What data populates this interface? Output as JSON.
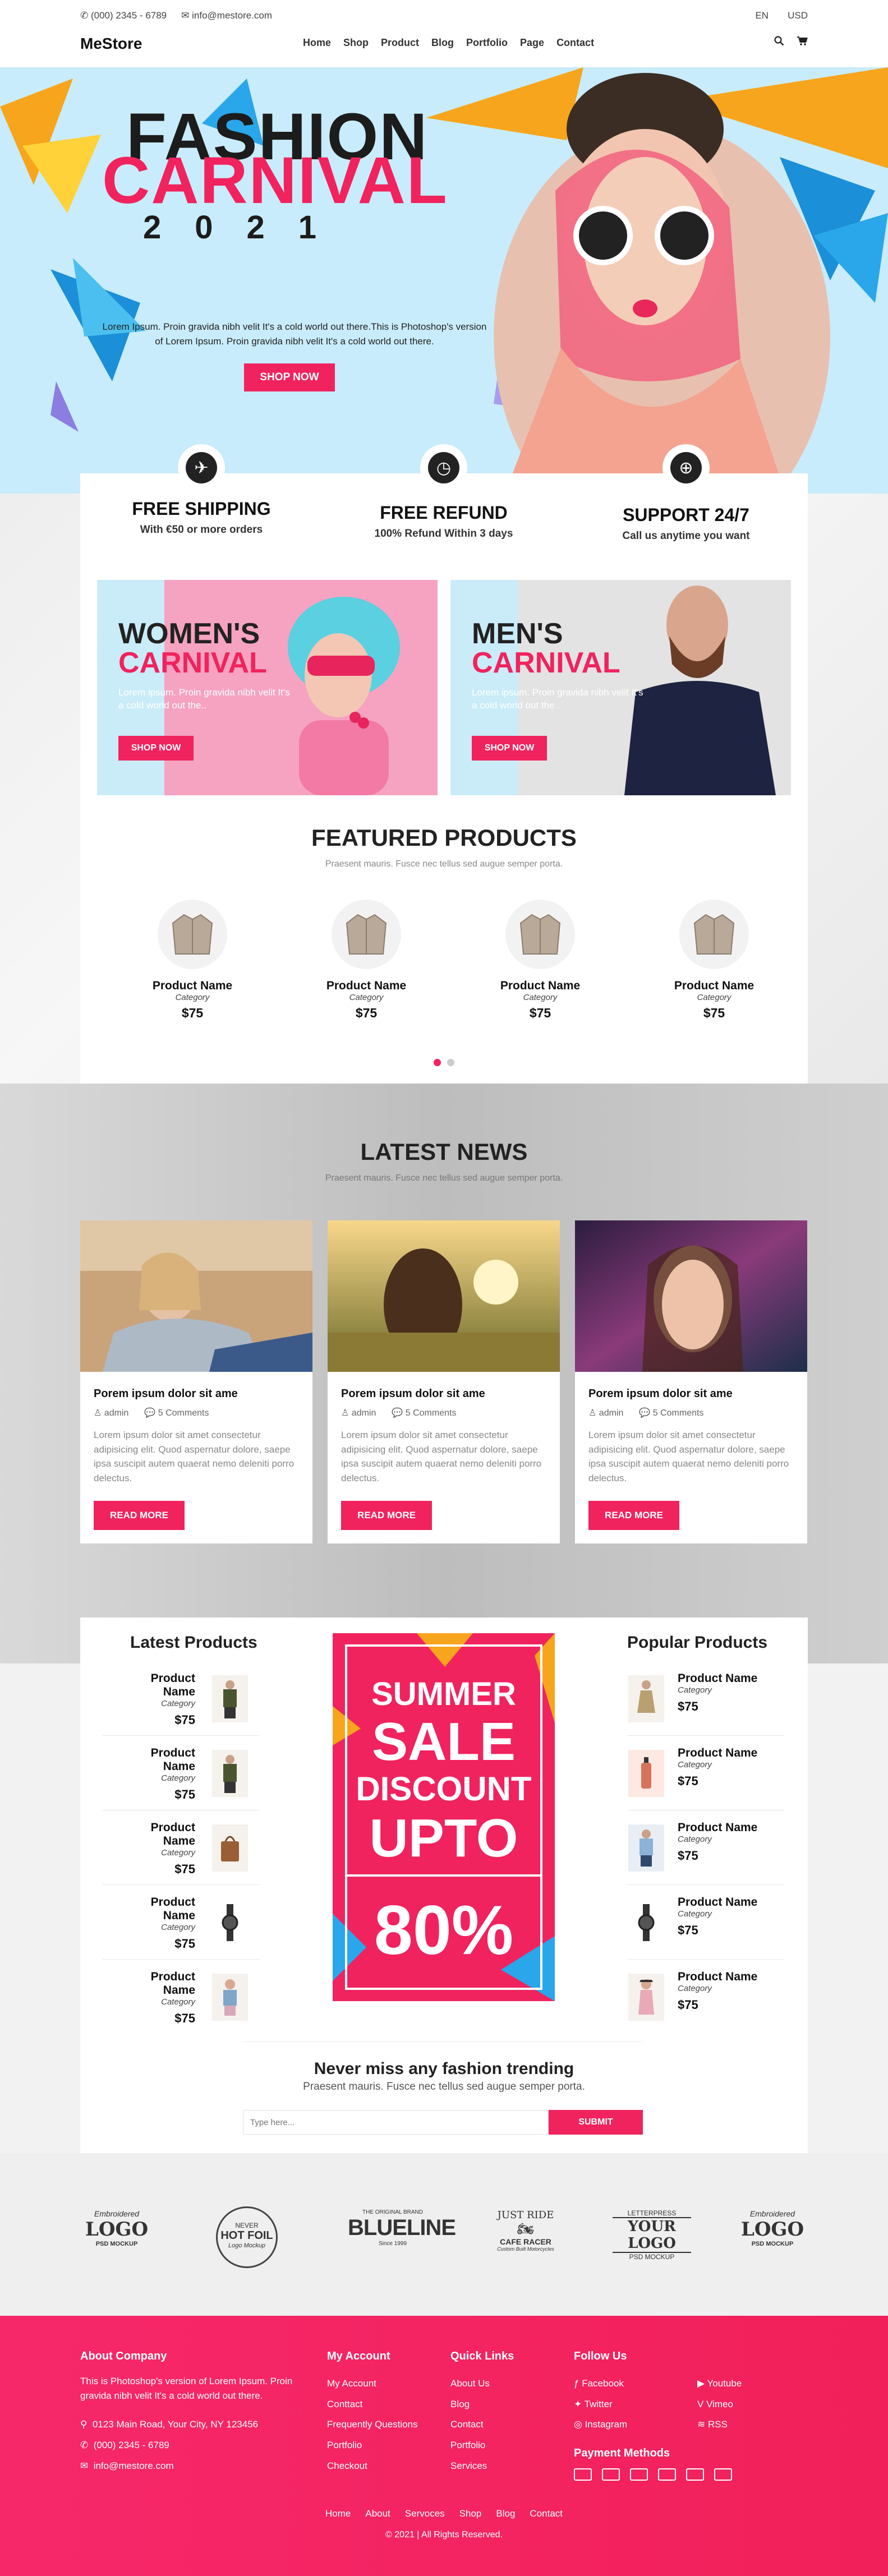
{
  "header": {
    "phone": "(000) 2345 - 6789",
    "email": "info@mestore.com",
    "language": "EN",
    "currency": "USD",
    "logo": "MeStore",
    "nav": [
      "Home",
      "Shop",
      "Product",
      "Blog",
      "Portfolio",
      "Page",
      "Contact"
    ]
  },
  "hero": {
    "title_line1": "FASHION",
    "title_line2": "CARNIVAL",
    "year": "2021",
    "description": "Lorem Ipsum. Proin gravida nibh velit It's a cold world out there.This is Photoshop's version of Lorem Ipsum. Proin gravida nibh velit It's a cold world out there.",
    "button": "SHOP NOW"
  },
  "features": [
    {
      "title": "FREE SHIPPING",
      "subtitle": "With €50 or more orders",
      "icon": "plane-icon"
    },
    {
      "title": "FREE REFUND",
      "subtitle": "100% Refund Within 3 days",
      "icon": "clock-icon"
    },
    {
      "title": "SUPPORT 24/7",
      "subtitle": "Call us anytime you want",
      "icon": "lifebuoy-icon"
    }
  ],
  "banners": [
    {
      "line1": "WOMEN'S",
      "line2": "CARNIVAL",
      "desc": "Lorem ipsum. Proin gravida nibh velit It's a cold world out the..",
      "button": "SHOP NOW"
    },
    {
      "line1": "MEN'S",
      "line2": "CARNIVAL",
      "desc": "Lorem ipsum. Proin gravida nibh velit It's a cold world out the..",
      "button": "SHOP NOW"
    }
  ],
  "featured": {
    "title": "FEATURED PRODUCTS",
    "subtitle": "Praesent mauris. Fusce nec tellus sed augue semper porta.",
    "products": [
      {
        "name": "Product Name",
        "category": "Category",
        "price": "$75"
      },
      {
        "name": "Product Name",
        "category": "Category",
        "price": "$75"
      },
      {
        "name": "Product Name",
        "category": "Category",
        "price": "$75"
      },
      {
        "name": "Product Name",
        "category": "Category",
        "price": "$75"
      }
    ]
  },
  "news": {
    "title": "LATEST NEWS",
    "subtitle": "Praesent mauris. Fusce nec tellus sed augue semper porta.",
    "posts": [
      {
        "title": "Porem ipsum dolor sit ame",
        "author": "admin",
        "comments": "5 Comments",
        "text": "Lorem ipsum dolor sit amet consectetur adipisicing elit. Quod aspernatur dolore, saepe ipsa suscipit autem quaerat nemo deleniti porro delectus.",
        "button": "READ MORE"
      },
      {
        "title": "Porem ipsum dolor sit ame",
        "author": "admin",
        "comments": "5 Comments",
        "text": "Lorem ipsum dolor sit amet consectetur adipisicing elit. Quod aspernatur dolore, saepe ipsa suscipit autem quaerat nemo deleniti porro delectus.",
        "button": "READ MORE"
      },
      {
        "title": "Porem ipsum dolor sit ame",
        "author": "admin",
        "comments": "5 Comments",
        "text": "Lorem ipsum dolor sit amet consectetur adipisicing elit. Quod aspernatur dolore, saepe ipsa suscipit autem quaerat nemo deleniti porro delectus.",
        "button": "READ MORE"
      }
    ]
  },
  "latest_products": {
    "title": "Latest Products",
    "items": [
      {
        "name": "Product Name",
        "category": "Category",
        "price": "$75"
      },
      {
        "name": "Product Name",
        "category": "Category",
        "price": "$75"
      },
      {
        "name": "Product Name",
        "category": "Category",
        "price": "$75"
      },
      {
        "name": "Product Name",
        "category": "Category",
        "price": "$75"
      },
      {
        "name": "Product Name",
        "category": "Category",
        "price": "$75"
      }
    ]
  },
  "popular_products": {
    "title": "Popular Products",
    "items": [
      {
        "name": "Product Name",
        "category": "Category",
        "price": "$75"
      },
      {
        "name": "Product Name",
        "category": "Category",
        "price": "$75"
      },
      {
        "name": "Product Name",
        "category": "Category",
        "price": "$75"
      },
      {
        "name": "Product Name",
        "category": "Category",
        "price": "$75"
      },
      {
        "name": "Product Name",
        "category": "Category",
        "price": "$75"
      }
    ]
  },
  "sale": {
    "line1": "SUMMER",
    "line2": "SALE",
    "line3": "DISCOUNT",
    "line4": "UPTO",
    "percent": "80%"
  },
  "newsletter": {
    "title": "Never miss any fashion trending",
    "subtitle": "Praesent mauris. Fusce nec tellus sed augue semper porta.",
    "placeholder": "Type here...",
    "button": "SUBMIT"
  },
  "brands": [
    {
      "top": "Embroidered",
      "main": "LOGO",
      "bottom": "PSD MOCKUP"
    },
    {
      "top": "NEVER",
      "main": "HOT FOIL",
      "bottom": "Logo Mockup"
    },
    {
      "top": "THE ORIGINAL BRAND",
      "main": "BLUELINE",
      "bottom": "Since 1999"
    },
    {
      "top": "JUST RIDE",
      "main": "CAFE RACER",
      "bottom": "Custom Built Motorcycles"
    },
    {
      "top": "LETTERPRESS",
      "main": "YOUR LOGO",
      "bottom": "PSD MOCKUP"
    },
    {
      "top": "Embroidered",
      "main": "LOGO",
      "bottom": "PSD MOCKUP"
    }
  ],
  "footer": {
    "about_title": "About Company",
    "about_text": "This is Photoshop's version of Lorem Ipsum. Proin gravida nibh velit It's a cold world out there.",
    "address": "0123 Main Road, Your City, NY 123456",
    "phone": "(000) 2345 - 6789",
    "email": "info@mestore.com",
    "account_title": "My Account",
    "account_links": [
      "My Account",
      "Conttact",
      "Frequently Questions",
      "Portfolio",
      "Checkout"
    ],
    "quick_title": "Quick Links",
    "quick_links": [
      "About Us",
      "Blog",
      "Contact",
      "Portfolio",
      "Services"
    ],
    "follow_title": "Follow Us",
    "social": [
      "Facebook",
      "Youtube",
      "Twitter",
      "Vimeo",
      "Instagram",
      "RSS"
    ],
    "payment_title": "Payment Methods",
    "bottom_links": [
      "Home",
      "About",
      "Servoces",
      "Shop",
      "Blog",
      "Contact"
    ],
    "copyright": "© 2021 | All Rights Reserved."
  },
  "colors": {
    "accent": "#f0235e",
    "hero_bg": "#c8ecfb"
  }
}
